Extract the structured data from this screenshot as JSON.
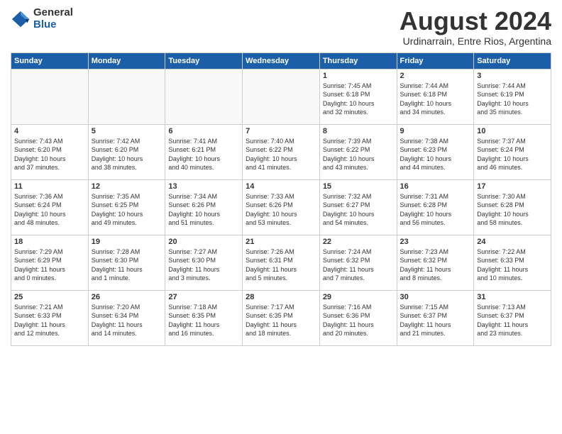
{
  "logo": {
    "general": "General",
    "blue": "Blue"
  },
  "header": {
    "month_year": "August 2024",
    "location": "Urdinarrain, Entre Rios, Argentina"
  },
  "weekdays": [
    "Sunday",
    "Monday",
    "Tuesday",
    "Wednesday",
    "Thursday",
    "Friday",
    "Saturday"
  ],
  "rows": [
    [
      {
        "day": "",
        "text": ""
      },
      {
        "day": "",
        "text": ""
      },
      {
        "day": "",
        "text": ""
      },
      {
        "day": "",
        "text": ""
      },
      {
        "day": "1",
        "text": "Sunrise: 7:45 AM\nSunset: 6:18 PM\nDaylight: 10 hours\nand 32 minutes."
      },
      {
        "day": "2",
        "text": "Sunrise: 7:44 AM\nSunset: 6:18 PM\nDaylight: 10 hours\nand 34 minutes."
      },
      {
        "day": "3",
        "text": "Sunrise: 7:44 AM\nSunset: 6:19 PM\nDaylight: 10 hours\nand 35 minutes."
      }
    ],
    [
      {
        "day": "4",
        "text": "Sunrise: 7:43 AM\nSunset: 6:20 PM\nDaylight: 10 hours\nand 37 minutes."
      },
      {
        "day": "5",
        "text": "Sunrise: 7:42 AM\nSunset: 6:20 PM\nDaylight: 10 hours\nand 38 minutes."
      },
      {
        "day": "6",
        "text": "Sunrise: 7:41 AM\nSunset: 6:21 PM\nDaylight: 10 hours\nand 40 minutes."
      },
      {
        "day": "7",
        "text": "Sunrise: 7:40 AM\nSunset: 6:22 PM\nDaylight: 10 hours\nand 41 minutes."
      },
      {
        "day": "8",
        "text": "Sunrise: 7:39 AM\nSunset: 6:22 PM\nDaylight: 10 hours\nand 43 minutes."
      },
      {
        "day": "9",
        "text": "Sunrise: 7:38 AM\nSunset: 6:23 PM\nDaylight: 10 hours\nand 44 minutes."
      },
      {
        "day": "10",
        "text": "Sunrise: 7:37 AM\nSunset: 6:24 PM\nDaylight: 10 hours\nand 46 minutes."
      }
    ],
    [
      {
        "day": "11",
        "text": "Sunrise: 7:36 AM\nSunset: 6:24 PM\nDaylight: 10 hours\nand 48 minutes."
      },
      {
        "day": "12",
        "text": "Sunrise: 7:35 AM\nSunset: 6:25 PM\nDaylight: 10 hours\nand 49 minutes."
      },
      {
        "day": "13",
        "text": "Sunrise: 7:34 AM\nSunset: 6:26 PM\nDaylight: 10 hours\nand 51 minutes."
      },
      {
        "day": "14",
        "text": "Sunrise: 7:33 AM\nSunset: 6:26 PM\nDaylight: 10 hours\nand 53 minutes."
      },
      {
        "day": "15",
        "text": "Sunrise: 7:32 AM\nSunset: 6:27 PM\nDaylight: 10 hours\nand 54 minutes."
      },
      {
        "day": "16",
        "text": "Sunrise: 7:31 AM\nSunset: 6:28 PM\nDaylight: 10 hours\nand 56 minutes."
      },
      {
        "day": "17",
        "text": "Sunrise: 7:30 AM\nSunset: 6:28 PM\nDaylight: 10 hours\nand 58 minutes."
      }
    ],
    [
      {
        "day": "18",
        "text": "Sunrise: 7:29 AM\nSunset: 6:29 PM\nDaylight: 11 hours\nand 0 minutes."
      },
      {
        "day": "19",
        "text": "Sunrise: 7:28 AM\nSunset: 6:30 PM\nDaylight: 11 hours\nand 1 minute."
      },
      {
        "day": "20",
        "text": "Sunrise: 7:27 AM\nSunset: 6:30 PM\nDaylight: 11 hours\nand 3 minutes."
      },
      {
        "day": "21",
        "text": "Sunrise: 7:26 AM\nSunset: 6:31 PM\nDaylight: 11 hours\nand 5 minutes."
      },
      {
        "day": "22",
        "text": "Sunrise: 7:24 AM\nSunset: 6:32 PM\nDaylight: 11 hours\nand 7 minutes."
      },
      {
        "day": "23",
        "text": "Sunrise: 7:23 AM\nSunset: 6:32 PM\nDaylight: 11 hours\nand 8 minutes."
      },
      {
        "day": "24",
        "text": "Sunrise: 7:22 AM\nSunset: 6:33 PM\nDaylight: 11 hours\nand 10 minutes."
      }
    ],
    [
      {
        "day": "25",
        "text": "Sunrise: 7:21 AM\nSunset: 6:33 PM\nDaylight: 11 hours\nand 12 minutes."
      },
      {
        "day": "26",
        "text": "Sunrise: 7:20 AM\nSunset: 6:34 PM\nDaylight: 11 hours\nand 14 minutes."
      },
      {
        "day": "27",
        "text": "Sunrise: 7:18 AM\nSunset: 6:35 PM\nDaylight: 11 hours\nand 16 minutes."
      },
      {
        "day": "28",
        "text": "Sunrise: 7:17 AM\nSunset: 6:35 PM\nDaylight: 11 hours\nand 18 minutes."
      },
      {
        "day": "29",
        "text": "Sunrise: 7:16 AM\nSunset: 6:36 PM\nDaylight: 11 hours\nand 20 minutes."
      },
      {
        "day": "30",
        "text": "Sunrise: 7:15 AM\nSunset: 6:37 PM\nDaylight: 11 hours\nand 21 minutes."
      },
      {
        "day": "31",
        "text": "Sunrise: 7:13 AM\nSunset: 6:37 PM\nDaylight: 11 hours\nand 23 minutes."
      }
    ]
  ]
}
